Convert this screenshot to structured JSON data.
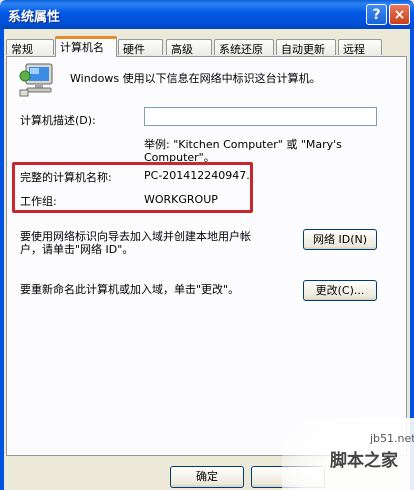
{
  "window": {
    "title": "系统属性",
    "help_btn": "?",
    "close_btn": "×"
  },
  "tabs": [
    {
      "label": "常规"
    },
    {
      "label": "计算机名",
      "active": true
    },
    {
      "label": "硬件"
    },
    {
      "label": "高级"
    },
    {
      "label": "系统还原"
    },
    {
      "label": "自动更新"
    },
    {
      "label": "远程"
    }
  ],
  "intro": "Windows 使用以下信息在网络中标识这台计算机。",
  "description": {
    "label": "计算机描述(D):",
    "value": "",
    "example_line1": "举例: \"Kitchen Computer\" 或 \"Mary's",
    "example_line2": "Computer\"。"
  },
  "full_name": {
    "label": "完整的计算机名称:",
    "value": "PC-201412240947."
  },
  "workgroup": {
    "label": "工作组:",
    "value": "WORKGROUP"
  },
  "network_section": {
    "text_line1": "要使用网络标识向导去加入域并创建本地用户帐",
    "text_line2": "户，请单击\"网络 ID\"。",
    "button": "网络 ID(N)"
  },
  "rename_section": {
    "text": "要重新命名此计算机或加入域，单击\"更改\"。",
    "button": "更改(C)..."
  },
  "footer": {
    "ok": "确定"
  },
  "watermark": {
    "url": "jb51.net",
    "text": "脚本之家"
  }
}
